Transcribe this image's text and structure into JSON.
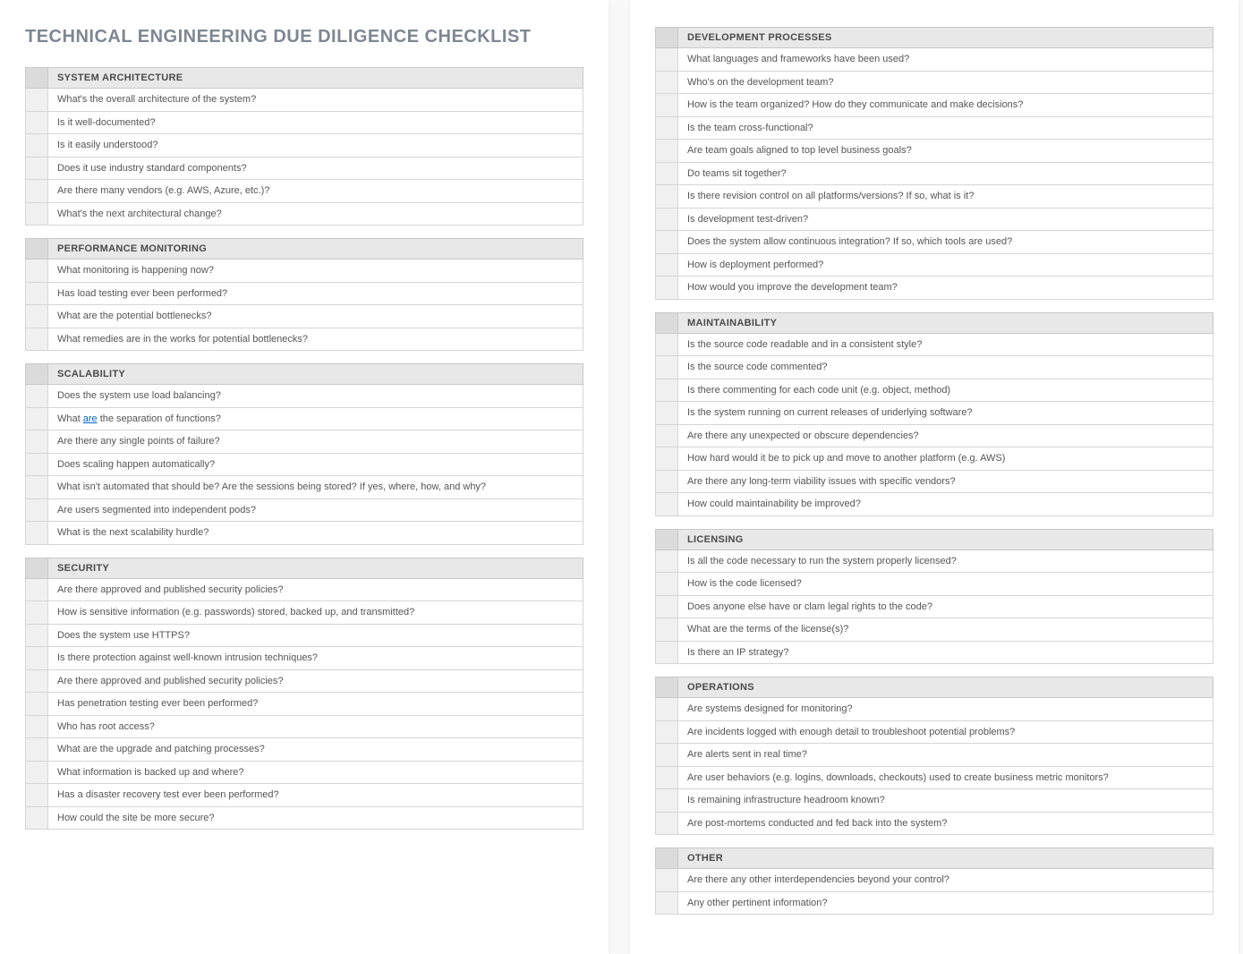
{
  "title": "TECHNICAL ENGINEERING DUE DILIGENCE CHECKLIST",
  "sections_left": [
    {
      "heading": "SYSTEM ARCHITECTURE",
      "items": [
        "What's the overall architecture of the system?",
        "Is it well-documented?",
        "Is it easily understood?",
        "Does it use industry standard components?",
        "Are there many vendors (e.g. AWS, Azure, etc.)?",
        "What's the next architectural change?"
      ]
    },
    {
      "heading": "PERFORMANCE MONITORING",
      "items": [
        "What monitoring is happening now?",
        "Has load testing ever been performed?",
        "What are the potential bottlenecks?",
        "What remedies are in the works for potential bottlenecks?"
      ]
    },
    {
      "heading": "SCALABILITY",
      "items": [
        "Does the system use load balancing?",
        {
          "pre": "What ",
          "u": "are",
          "post": " the separation of functions?"
        },
        "Are there any single points of failure?",
        "Does scaling happen automatically?",
        "What isn't automated that should be? Are the sessions being stored? If yes, where, how, and why?",
        "Are users segmented into independent pods?",
        "What is the next scalability hurdle?"
      ]
    },
    {
      "heading": "SECURITY",
      "items": [
        "Are there approved and published security policies?",
        "How is sensitive information (e.g. passwords) stored, backed up, and transmitted?",
        "Does the system use HTTPS?",
        "Is there protection against well-known intrusion techniques?",
        "Are there approved and published security policies?",
        "Has penetration testing ever been performed?",
        "Who has root access?",
        "What are the upgrade and patching processes?",
        "What information is backed up and where?",
        "Has a disaster recovery test ever been performed?",
        "How could the site be more secure?"
      ]
    }
  ],
  "sections_right": [
    {
      "heading": "DEVELOPMENT PROCESSES",
      "items": [
        "What languages and frameworks have been used?",
        "Who's on the development team?",
        "How is the team organized? How do they communicate and make decisions?",
        "Is the team cross-functional?",
        "Are team goals aligned to top level business goals?",
        "Do teams sit together?",
        "Is there revision control on all platforms/versions? If so, what is it?",
        "Is development test-driven?",
        "Does the system allow continuous integration? If so, which tools are used?",
        "How is deployment performed?",
        "How would you improve the development team?"
      ]
    },
    {
      "heading": "MAINTAINABILITY",
      "items": [
        "Is the source code readable and in a consistent style?",
        "Is the source code commented?",
        "Is there commenting for each code unit (e.g. object, method)",
        "Is the system running on current releases of underlying software?",
        "Are there any unexpected or obscure dependencies?",
        "How hard would it be to pick up and move to another platform (e.g. AWS)",
        "Are there any long-term viability issues with specific vendors?",
        "How could maintainability be improved?"
      ]
    },
    {
      "heading": "LICENSING",
      "items": [
        "Is all the code necessary to run the system properly licensed?",
        "How is the code licensed?",
        "Does anyone else have or clam legal rights to the code?",
        "What are the terms of the license(s)?",
        "Is there an IP strategy?"
      ]
    },
    {
      "heading": "OPERATIONS",
      "items": [
        "Are systems designed for monitoring?",
        "Are incidents logged with enough detail to troubleshoot potential problems?",
        "Are alerts sent in real time?",
        "Are user behaviors (e.g. logins, downloads, checkouts) used to create business metric monitors?",
        "Is remaining infrastructure headroom known?",
        "Are post-mortems conducted and fed back into the system?"
      ]
    },
    {
      "heading": "OTHER",
      "items": [
        "Are there any other interdependencies beyond your control?",
        "Any other pertinent information?"
      ]
    }
  ]
}
